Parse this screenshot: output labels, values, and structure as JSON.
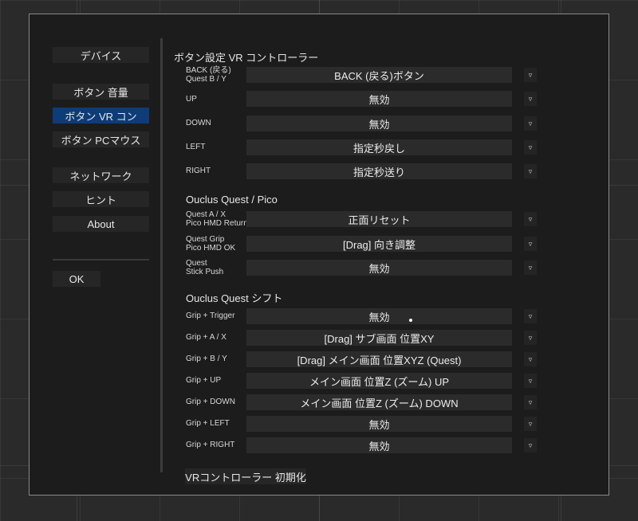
{
  "sidebar": {
    "device": "デバイス",
    "button_volume": "ボタン 音量",
    "button_vr": "ボタン VR コン",
    "button_pc_mouse": "ボタン PCマウス",
    "network": "ネットワーク",
    "hint": "ヒント",
    "about": "About",
    "ok": "OK"
  },
  "sections": {
    "vr": "ボタン設定 VR コントローラー",
    "quest_pico": "Ouclus Quest / Pico",
    "shift": "Ouclus Quest シフト"
  },
  "rows": [
    {
      "label": "BACK (戻る)\nQuest B / Y",
      "value": "BACK (戻る)ボタン"
    },
    {
      "label": "UP",
      "value": "無効"
    },
    {
      "label": "DOWN",
      "value": "無効"
    },
    {
      "label": "LEFT",
      "value": "指定秒戻し"
    },
    {
      "label": "RIGHT",
      "value": "指定秒送り"
    },
    {
      "label": "Quest A / X\nPico HMD Return",
      "value": "正面リセット"
    },
    {
      "label": "Quest Grip\nPico HMD OK",
      "value": "[Drag] 向き調整"
    },
    {
      "label": "Quest\nStick Push",
      "value": "無効"
    },
    {
      "label": "Grip + Trigger",
      "value": "無効"
    },
    {
      "label": "Grip + A / X",
      "value": "[Drag] サブ画面 位置XY"
    },
    {
      "label": "Grip + B / Y",
      "value": "[Drag] メイン画面 位置XYZ (Quest)"
    },
    {
      "label": "Grip + UP",
      "value": "メイン画面 位置Z (ズーム) UP"
    },
    {
      "label": "Grip + DOWN",
      "value": "メイン画面 位置Z (ズーム) DOWN"
    },
    {
      "label": "Grip + LEFT",
      "value": "無効"
    },
    {
      "label": "Grip + RIGHT",
      "value": "無効"
    }
  ],
  "dropdown_glyph": "▿",
  "reset_button": "VRコントローラー 初期化",
  "colors": {
    "dialog_bg": "#1c1c1c",
    "active": "#0d3c78",
    "field_bg": "#2b2b2b"
  }
}
